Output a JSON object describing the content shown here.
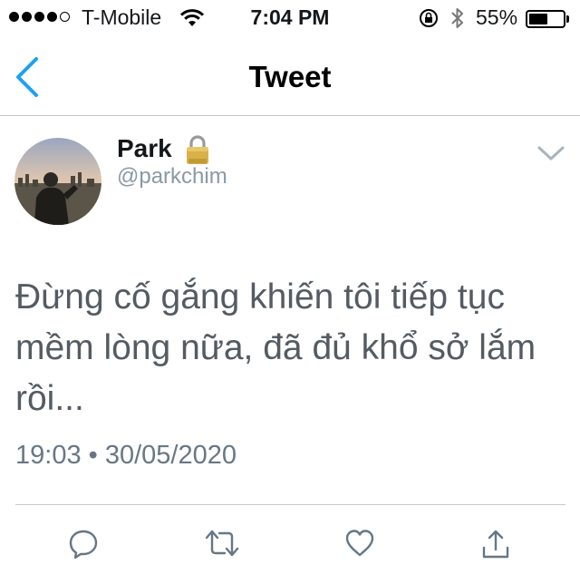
{
  "status_bar": {
    "carrier": "T-Mobile",
    "time": "7:04 PM",
    "battery_percent": "55%",
    "battery_level": 0.55,
    "signal_bars_filled": 4,
    "signal_bars_total": 5
  },
  "nav": {
    "title": "Tweet"
  },
  "tweet": {
    "author_name": "Park",
    "author_handle": "@parkchim",
    "protected": true,
    "text": "Đừng cố gắng khiến tôi tiếp tục mềm lòng nữa, đã đủ khổ sở lắm rồi...",
    "timestamp": "19:03 • 30/05/2020"
  },
  "actions": [
    "reply-icon",
    "retweet-icon",
    "like-icon",
    "share-icon"
  ],
  "colors": {
    "accent": "#1da1f2",
    "icon_gray": "#657786",
    "text_dim": "#545b62"
  }
}
